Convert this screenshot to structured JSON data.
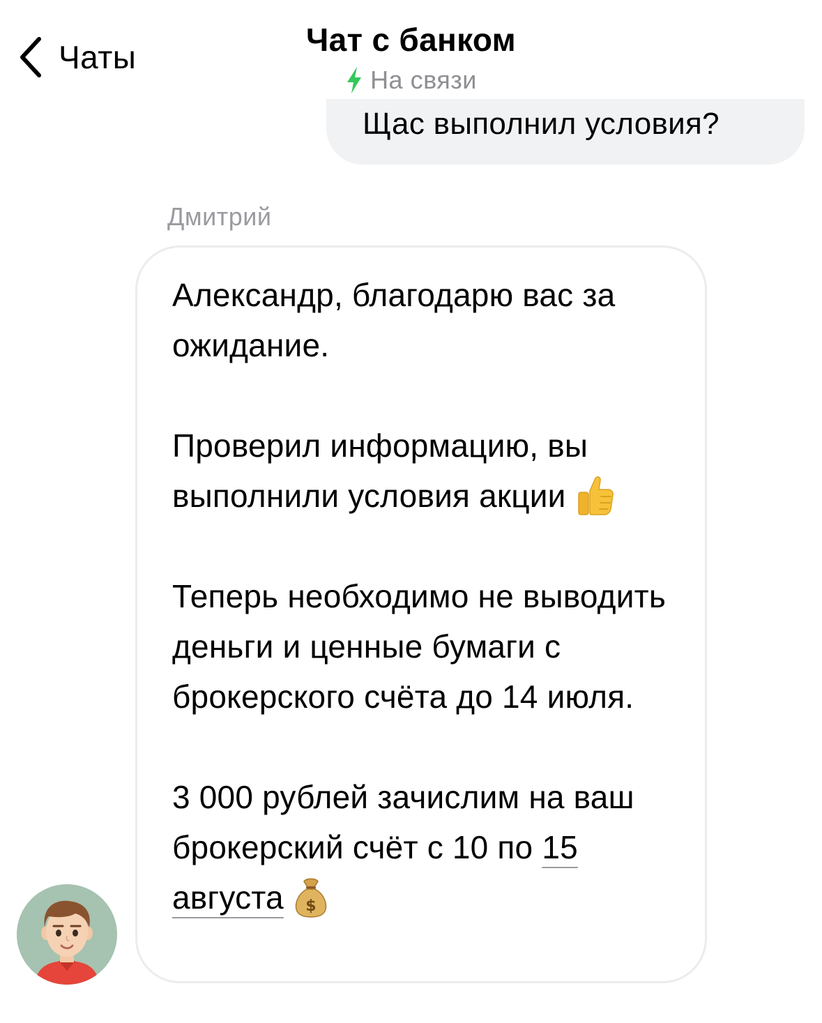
{
  "header": {
    "back_label": "Чаты",
    "title": "Чат с банком",
    "status": "На связи"
  },
  "colors": {
    "status_bolt": "#34c759",
    "outgoing_bubble": "#f1f2f4",
    "incoming_border": "#ececef",
    "secondary_text": "#8e8e93",
    "avatar_background": "#a6c2b0"
  },
  "messages": {
    "outgoing": {
      "text": "Щас выполнил условия?"
    },
    "incoming": {
      "sender": "Дмитрий",
      "paragraphs": [
        "Александр, благодарю вас за ожидание.",
        "Проверил информацию, вы выполнили условия акции",
        "Теперь необходимо не выводить деньги и ценные бумаги с брокерского счёта до 14 июля.",
        "3 000 рублей зачислим на ваш брокерский счёт с 10 по"
      ],
      "date_link": "15 августа",
      "icons": [
        "thumbs-up-icon",
        "money-bag-icon"
      ]
    }
  }
}
